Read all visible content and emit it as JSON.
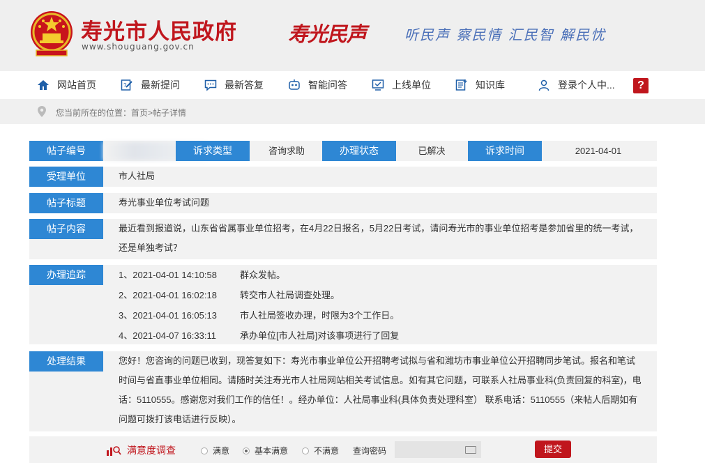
{
  "header": {
    "site_title": "寿光市人民政府",
    "site_url": "www.shouguang.gov.cn",
    "brand": "寿光民声",
    "slogan": "听民声 察民情 汇民智 解民忧",
    "colors": {
      "brand_red": "#c0161d",
      "slogan_blue": "#4a6fb8",
      "label_blue": "#2e87d4"
    }
  },
  "nav": {
    "items": [
      {
        "label": "网站首页",
        "icon": "home-icon"
      },
      {
        "label": "最新提问",
        "icon": "edit-question-icon"
      },
      {
        "label": "最新答复",
        "icon": "chat-reply-icon"
      },
      {
        "label": "智能问答",
        "icon": "robot-icon"
      },
      {
        "label": "上线单位",
        "icon": "monitor-icon"
      },
      {
        "label": "知识库",
        "icon": "knowledge-base-icon"
      },
      {
        "label": "登录个人中...",
        "icon": "user-icon"
      }
    ],
    "help_label": "?"
  },
  "breadcrumb": {
    "text": "您当前所在的位置：首页>帖子详情"
  },
  "detail": {
    "post_id_label": "帖子编号",
    "type_label": "诉求类型",
    "type_value": "咨询求助",
    "status_label": "办理状态",
    "status_value": "已解决",
    "time_label": "诉求时间",
    "time_value": "2021-04-01",
    "unit_label": "受理单位",
    "unit_value": "市人社局",
    "title_label": "帖子标题",
    "title_value": "寿光事业单位考试问题",
    "content_label": "帖子内容",
    "content_value": "最近看到报道说，山东省省属事业单位招考，在4月22日报名，5月22日考试，请问寿光市的事业单位招考是参加省里的统一考试，还是单独考试？",
    "tracking_label": "办理追踪",
    "tracking": [
      {
        "time": "1、2021-04-01 14:10:58",
        "text": "群众发帖。"
      },
      {
        "time": "2、2021-04-01 16:02:18",
        "text": "转交市人社局调查处理。"
      },
      {
        "time": "3、2021-04-01 16:05:13",
        "text": "市人社局签收办理，时限为3个工作日。"
      },
      {
        "time": "4、2021-04-07 16:33:11",
        "text": "承办单位[市人社局]对该事项进行了回复"
      }
    ],
    "result_label": "处理结果",
    "result_value": "您好！您咨询的问题已收到，现答复如下：寿光市事业单位公开招聘考试拟与省和潍坊市事业单位公开招聘同步笔试。报名和笔试时间与省直事业单位相同。请随时关注寿光市人社局网站相关考试信息。如有其它问题，可联系人社局事业科(负责回复的科室)，电话：5110555。感谢您对我们工作的信任！。经办单位：人社局事业科(具体负责处理科室） 联系电话：5110555（来帖人后期如有问题可拨打该电话进行反映）。"
  },
  "survey": {
    "title": "满意度调查",
    "options": [
      "满意",
      "基本满意",
      "不满意"
    ],
    "selected": "基本满意",
    "password_label": "查询密码",
    "submit_label": "提交"
  }
}
